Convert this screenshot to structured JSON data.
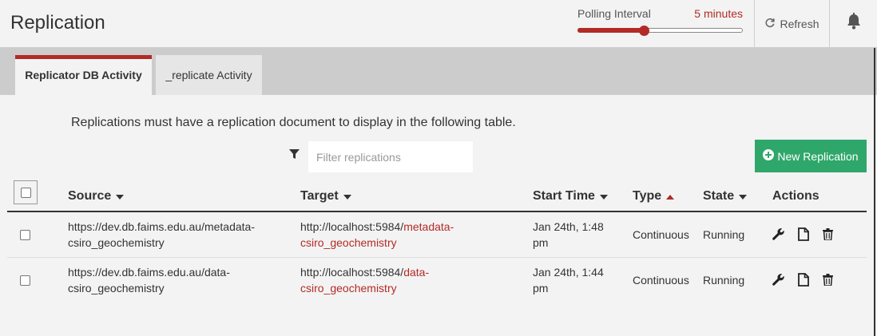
{
  "header": {
    "title": "Replication",
    "polling_label": "Polling Interval",
    "polling_value": "5 minutes",
    "polling_level": 0.4,
    "refresh_label": "Refresh"
  },
  "tabs": [
    {
      "label": "Replicator DB Activity",
      "active": true
    },
    {
      "label": "_replicate Activity",
      "active": false
    }
  ],
  "main": {
    "info": "Replications must have a replication document to display in the following table.",
    "filter_placeholder": "Filter replications",
    "new_button_label": "New Replication"
  },
  "table": {
    "columns": {
      "source": "Source",
      "target": "Target",
      "start_time": "Start Time",
      "type": "Type",
      "state": "State",
      "actions": "Actions"
    },
    "rows": [
      {
        "source_line1": "https://dev.db.faims.edu.au/metadata-",
        "source_line2": "csiro_geochemistry",
        "target_prefix": "http://localhost:5984/",
        "target_link1": "metadata-",
        "target_link2": "csiro_geochemistry",
        "start_line1": "Jan 24th, 1:48",
        "start_line2": "pm",
        "type": "Continuous",
        "state": "Running"
      },
      {
        "source_line1": "https://dev.db.faims.edu.au/data-",
        "source_line2": "csiro_geochemistry",
        "target_prefix": "http://localhost:5984/",
        "target_link1": "data-",
        "target_link2": "csiro_geochemistry",
        "start_line1": "Jan 24th, 1:44",
        "start_line2": "pm",
        "type": "Continuous",
        "state": "Running"
      }
    ]
  },
  "colors": {
    "accent": "#b22b27",
    "success": "#2fa76b"
  }
}
